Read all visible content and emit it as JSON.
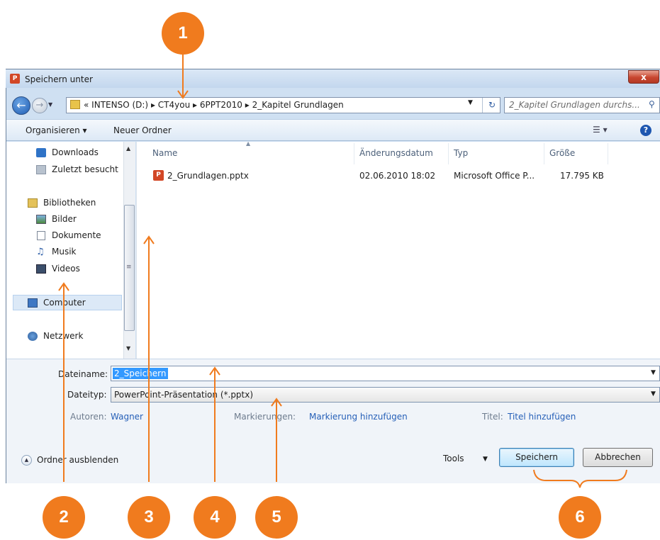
{
  "window": {
    "title": "Speichern unter",
    "close_glyph": "x",
    "app_icon_glyph": "P"
  },
  "address": {
    "crumbs": [
      "«",
      "INTENSO (D:)",
      "▸",
      "CT4you",
      "▸",
      "6PPT2010",
      "▸",
      "2_Kapitel  Grundlagen"
    ],
    "search_placeholder": "2_Kapitel  Grundlagen durchs..."
  },
  "toolbar": {
    "organize_label": "Organisieren ▾",
    "new_folder_label": "Neuer Ordner",
    "help_glyph": "?"
  },
  "navpane": {
    "items": [
      {
        "label": "Downloads",
        "icon": "downloads-icon"
      },
      {
        "label": "Zuletzt besucht",
        "icon": "recent-places-icon"
      },
      {
        "label": "Bibliotheken",
        "icon": "libraries-icon"
      },
      {
        "label": "Bilder",
        "icon": "pictures-icon"
      },
      {
        "label": "Dokumente",
        "icon": "documents-icon"
      },
      {
        "label": "Musik",
        "icon": "music-icon"
      },
      {
        "label": "Videos",
        "icon": "videos-icon"
      },
      {
        "label": "Computer",
        "icon": "computer-icon"
      },
      {
        "label": "Netzwerk",
        "icon": "network-icon"
      }
    ]
  },
  "filelist": {
    "columns": [
      "Name",
      "Änderungsdatum",
      "Typ",
      "Größe"
    ],
    "rows": [
      {
        "name": "2_Grundlagen.pptx",
        "date": "02.06.2010 18:02",
        "type": "Microsoft Office P...",
        "size": "17.795 KB"
      }
    ]
  },
  "form": {
    "filename_label": "Dateiname:",
    "filename_value": "2_Speichern",
    "filetype_label": "Dateityp:",
    "filetype_value": "PowerPoint-Präsentation (*.pptx)",
    "authors_label": "Autoren:",
    "authors_value": "Wagner",
    "tags_label": "Markierungen:",
    "tags_value": "Markierung hinzufügen",
    "title_label": "Titel:",
    "title_value": "Titel hinzufügen"
  },
  "footer": {
    "hide_folders_label": "Ordner ausblenden",
    "tools_label": "Tools",
    "save_label": "Speichern",
    "cancel_label": "Abbrechen"
  },
  "annotations": [
    "1",
    "2",
    "3",
    "4",
    "5",
    "6"
  ],
  "colors": {
    "annotation": "#f07b1e",
    "selection": "#3399ff",
    "link": "#2660b8"
  }
}
